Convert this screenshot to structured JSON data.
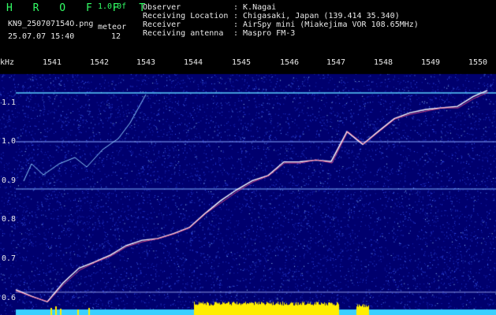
{
  "header": {
    "logo": "H R O F F T",
    "version": "1.0.0f",
    "filename": "KN9_250707154O.png",
    "datetime": "25.07.07 15:40",
    "meteor_label": "meteor",
    "meteor_count": "12",
    "info": [
      {
        "label": "Observer",
        "value": ": K.Nagai"
      },
      {
        "label": "Receiving Location",
        "value": ": Chigasaki, Japan (139.414 35.340)"
      },
      {
        "label": "Receiver",
        "value": ": AirSpy mini (Miakejima VOR 108.65MHz)"
      },
      {
        "label": "Receiving antenna",
        "value": ": Maspro FM-3"
      }
    ]
  },
  "time_axis": {
    "ticks": [
      "1541",
      "1542",
      "1543",
      "1544",
      "1545",
      "1546",
      "1547",
      "1548",
      "1549",
      "1550"
    ]
  },
  "freq_axis": {
    "unit": "kHz",
    "ticks": [
      "1.1",
      "1.0",
      "0.9",
      "0.8",
      "0.7",
      "0.6"
    ]
  },
  "colors": {
    "background": "#00006e",
    "noise": "#3a58ff",
    "trace": "#ffffff",
    "trace_accent": "#ff5080",
    "carrier": "#5ad0ff",
    "bottom_cyan": "#39d0ff",
    "bottom_yellow": "#ffee00"
  }
}
